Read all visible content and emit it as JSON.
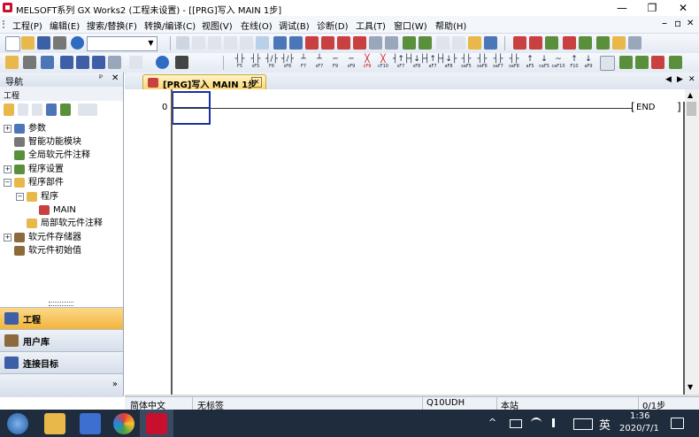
{
  "window": {
    "title": "MELSOFT系列 GX Works2 (工程未设置) - [[PRG]写入 MAIN 1步]",
    "controls": {
      "minimize": "—",
      "restore": "❐",
      "close": "✕"
    }
  },
  "menu": {
    "items": [
      "工程(P)",
      "编辑(E)",
      "搜索/替换(F)",
      "转换/编译(C)",
      "视图(V)",
      "在线(O)",
      "调试(B)",
      "诊断(D)",
      "工具(T)",
      "窗口(W)",
      "帮助(H)"
    ],
    "doc_controls": {
      "minimize": "–",
      "restore": "▫",
      "close": "✕"
    }
  },
  "fkeys": [
    {
      "sym": "┤├",
      "lbl": "F5"
    },
    {
      "sym": "┤├",
      "lbl": "sF5"
    },
    {
      "sym": "┤/├",
      "lbl": "F6"
    },
    {
      "sym": "┤/├",
      "lbl": "sF6"
    },
    {
      "sym": "┴",
      "lbl": "F7"
    },
    {
      "sym": "┴",
      "lbl": "sF7"
    },
    {
      "sym": "─",
      "lbl": "F9"
    },
    {
      "sym": "─",
      "lbl": "sF9"
    },
    {
      "sym": "╳",
      "lbl": "cF9"
    },
    {
      "sym": "╳",
      "lbl": "cF10"
    },
    {
      "sym": "┤↑├",
      "lbl": "sF7"
    },
    {
      "sym": "┤↓├",
      "lbl": "sF8"
    },
    {
      "sym": "┤↑├",
      "lbl": "aF7"
    },
    {
      "sym": "┤↓├",
      "lbl": "aF8"
    },
    {
      "sym": "┤├",
      "lbl": "saF5"
    },
    {
      "sym": "┤├",
      "lbl": "saF6"
    },
    {
      "sym": "┤├",
      "lbl": "saF7"
    },
    {
      "sym": "┤├",
      "lbl": "saF8"
    },
    {
      "sym": "↑",
      "lbl": "aF5"
    },
    {
      "sym": "↓",
      "lbl": "caF5"
    },
    {
      "sym": "~",
      "lbl": "caF10"
    },
    {
      "sym": "↑",
      "lbl": "F10"
    },
    {
      "sym": "↓",
      "lbl": "aF9"
    }
  ],
  "nav": {
    "title": "导航",
    "pin": "ᵖ",
    "close": "✕",
    "section_label": "工程",
    "tree": [
      {
        "label": "参数",
        "expander": "+",
        "level": 0
      },
      {
        "label": "智能功能模块",
        "expander": "",
        "level": 0
      },
      {
        "label": "全局软元件注释",
        "expander": "",
        "level": 0
      },
      {
        "label": "程序设置",
        "expander": "+",
        "level": 0
      },
      {
        "label": "程序部件",
        "expander": "−",
        "level": 0
      },
      {
        "label": "程序",
        "expander": "−",
        "level": 1
      },
      {
        "label": "MAIN",
        "expander": "",
        "level": 2
      },
      {
        "label": "局部软元件注释",
        "expander": "",
        "level": 1
      },
      {
        "label": "软元件存储器",
        "expander": "+",
        "level": 0
      },
      {
        "label": "软元件初始值",
        "expander": "",
        "level": 0
      }
    ],
    "bottom_buttons": [
      "工程",
      "用户库",
      "连接目标"
    ],
    "more": "»"
  },
  "tab": {
    "label": "[PRG]写入 MAIN 1步",
    "close": "✕",
    "scroll_left": "◀",
    "scroll_right": "▶",
    "tab_close": "✕"
  },
  "ladder": {
    "step": "0",
    "end_label": "END"
  },
  "status": {
    "language": "简体中文",
    "label": "无标签",
    "cpu": "Q10UDH",
    "station": "本站",
    "steps": "0/1步"
  },
  "taskbar": {
    "ime": "英",
    "time": "1:36",
    "date": "2020/7/1",
    "tray_chevron": "^"
  },
  "colors": {
    "accent_tab": "#fbd46a",
    "cursor": "#1c2f9e",
    "taskbar": "#1f2c3d"
  }
}
